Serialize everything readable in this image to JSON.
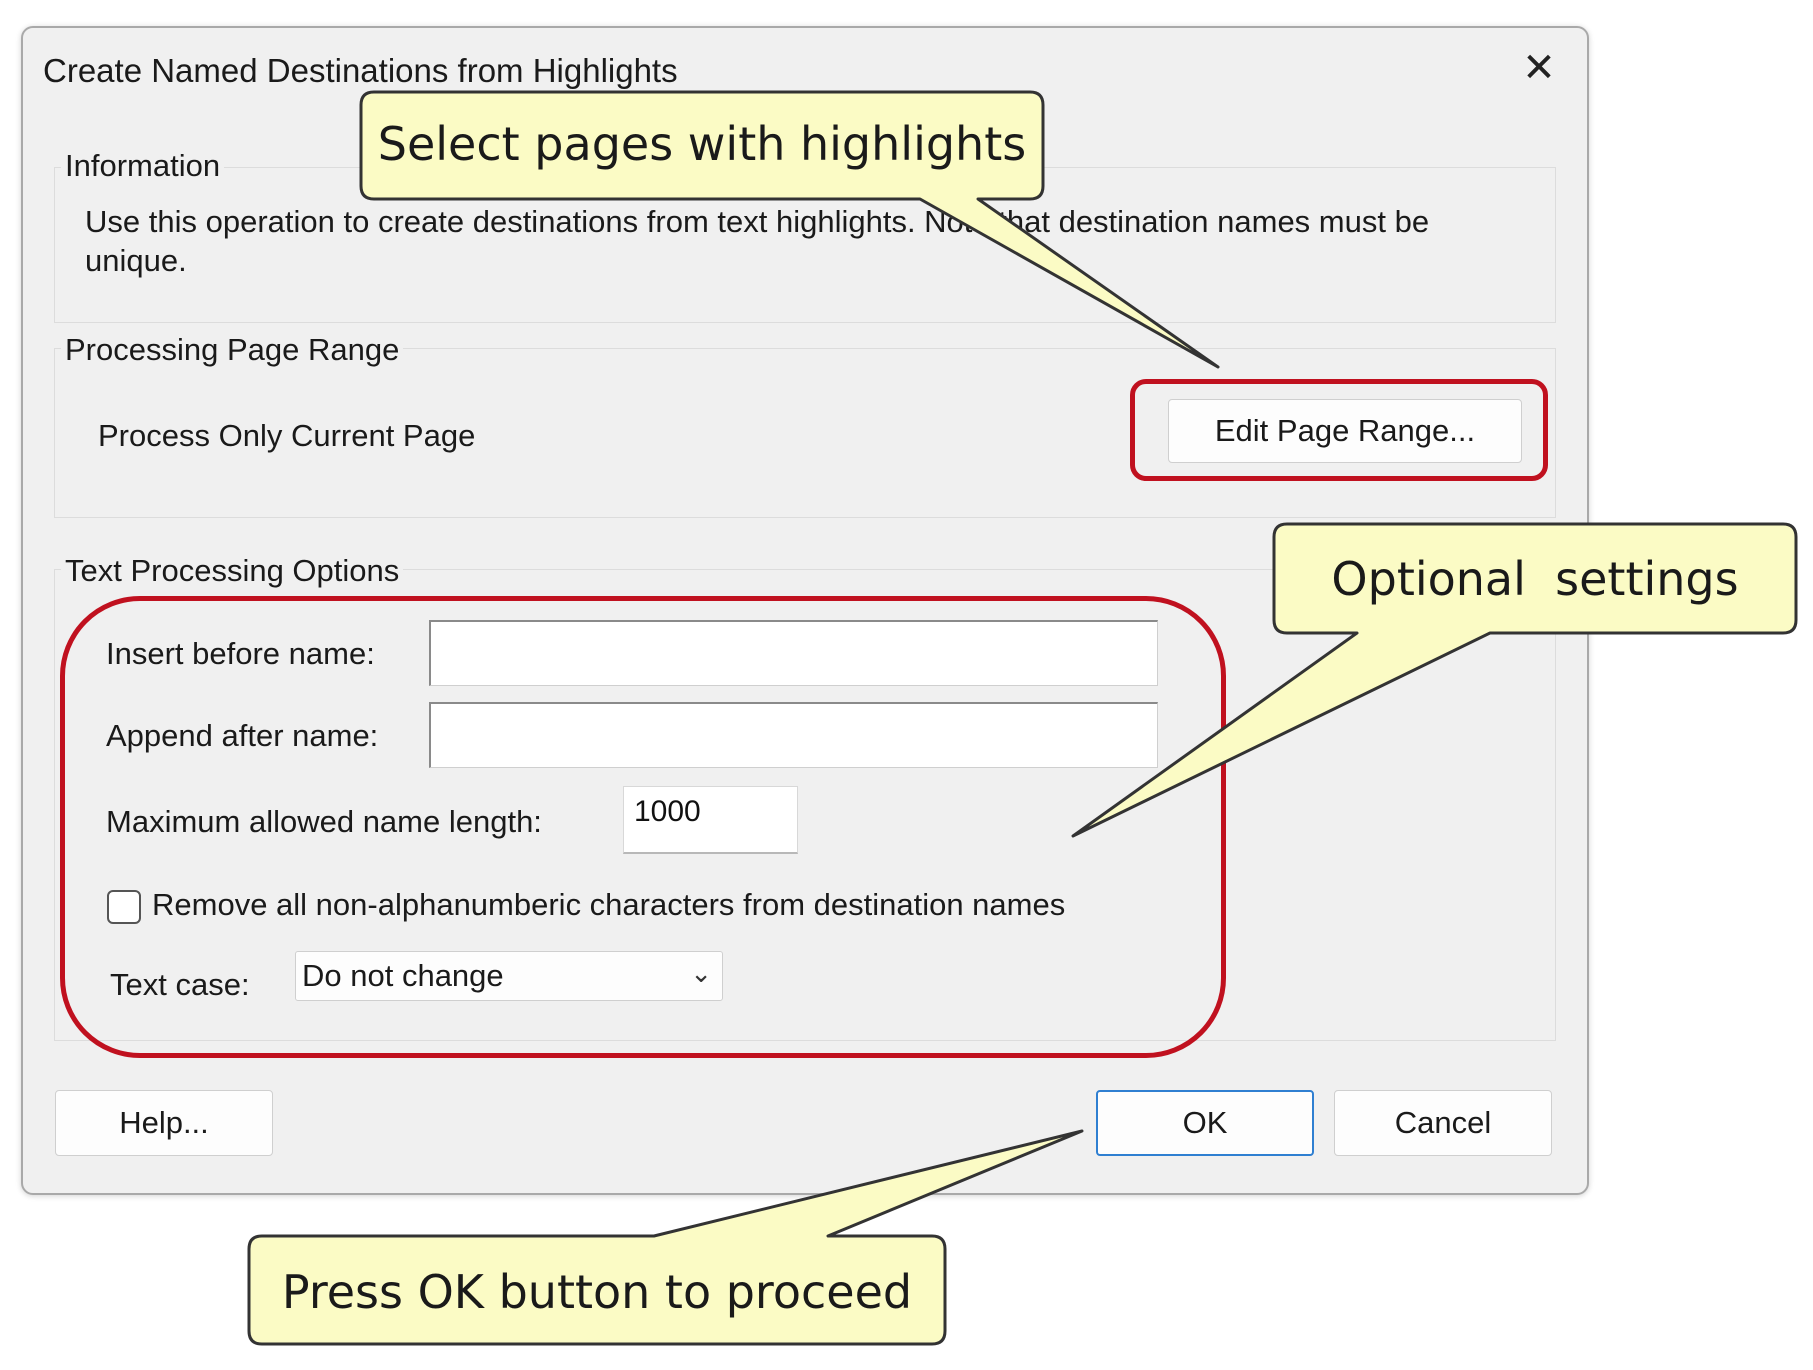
{
  "dialog": {
    "title": "Create Named Destinations from Highlights",
    "close_icon": "close-icon"
  },
  "information": {
    "label": "Information",
    "text": "Use this operation to create destinations from text highlights. Note that destination names must be unique."
  },
  "page_range": {
    "label": "Processing Page Range",
    "current": "Process Only Current Page",
    "edit_button": "Edit Page Range..."
  },
  "text_options": {
    "label": "Text Processing Options",
    "insert_before_label": "Insert before name:",
    "insert_before_value": "",
    "append_after_label": "Append after name:",
    "append_after_value": "",
    "max_length_label": "Maximum allowed name length:",
    "max_length_value": "1000",
    "remove_nonalnum_label": "Remove all non-alphanumberic characters from destination names",
    "remove_nonalnum_checked": false,
    "text_case_label": "Text case:",
    "text_case_value": "Do not change",
    "text_case_arrow": "chevron-down-icon"
  },
  "buttons": {
    "help": "Help...",
    "ok": "OK",
    "cancel": "Cancel"
  },
  "callouts": {
    "select_pages": "Select pages with highlights",
    "optional": "Optional  settings",
    "press_ok": "Press OK button to proceed"
  },
  "colors": {
    "highlight_frame": "#c0111f",
    "callout_fill": "#fbfbc5",
    "ok_border": "#2f7fd1"
  }
}
